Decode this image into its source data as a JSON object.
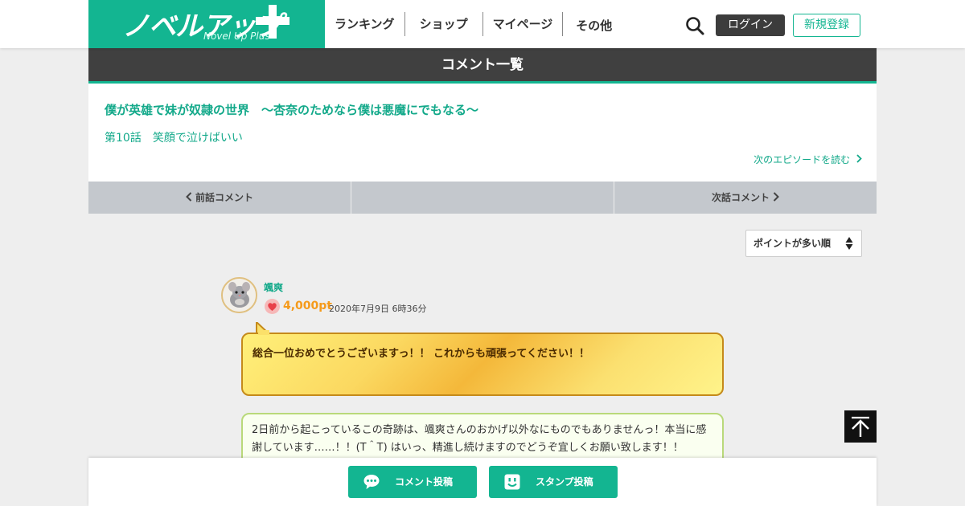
{
  "header": {
    "logo_text": "ノベルアップ",
    "logo_sub": "Novel Up Plus",
    "nav": [
      "ランキング",
      "ショップ",
      "マイページ",
      "その他"
    ],
    "login_label": "ログイン",
    "register_label": "新規登録"
  },
  "page_title": "コメント一覧",
  "work": {
    "title": "僕が英雄で妹が奴隷の世界　〜杏奈のためなら僕は悪魔にでもなる〜",
    "episode": "第10話　笑顔で泣けばいい",
    "next_episode_label": "次のエピソードを読む"
  },
  "pager": {
    "prev_label": "前話コメント",
    "middle_label": "",
    "next_label": "次話コメント"
  },
  "sort": {
    "selected": "ポイントが多い順"
  },
  "comment": {
    "username": "颯爽",
    "points": "4,000pt",
    "date": "2020年7月9日 6時36分",
    "text": "総合一位おめでとうございますっ！！ これからも頑張ってください！！"
  },
  "reply": {
    "text": "2日前から起こっているこの奇跡は、颯爽さんのおかげ以外なにものでもありませんっ！本当に感謝しています……！！(T＾T) はいっ、精進し続けますのでどうぞ宜しくお願い致します！！"
  },
  "bottom": {
    "comment_label": "コメント投稿",
    "stamp_label": "スタンプ投稿"
  },
  "colors": {
    "brand": "#13b591",
    "title_bar": "#404040",
    "points": "#f59a1a"
  }
}
